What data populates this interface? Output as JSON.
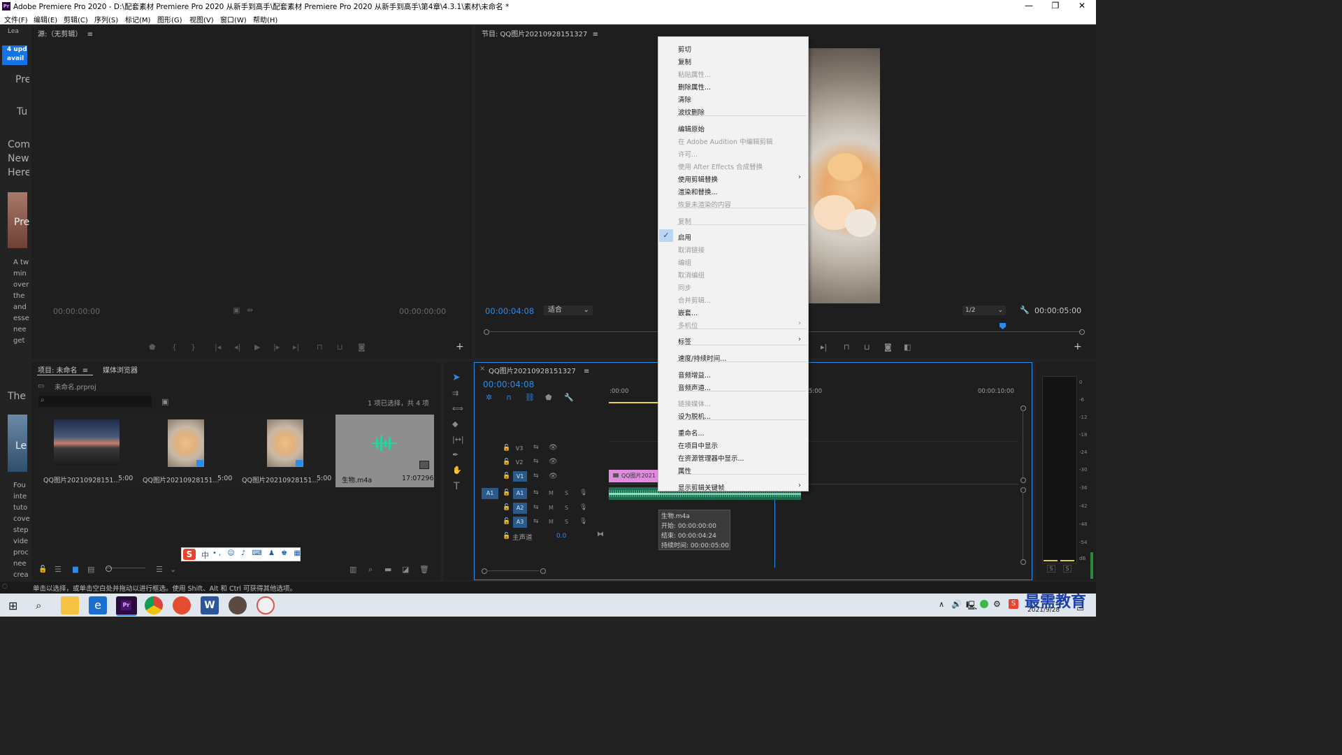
{
  "window": {
    "title": "Adobe Premiere Pro 2020 - D:\\配套素材 Premiere Pro 2020 从新手到高手\\配套素材 Premiere Pro 2020 从新手到高手\\第4章\\4.3.1\\素材\\未命名 *",
    "app_icon": "Pr",
    "minimize": "—",
    "restore": "❐",
    "close": "✕"
  },
  "menu": [
    "文件(F)",
    "编辑(E)",
    "剪辑(C)",
    "序列(S)",
    "标记(M)",
    "图形(G)",
    "视图(V)",
    "窗口(W)",
    "帮助(H)"
  ],
  "learn_panel": {
    "tab": "Lea",
    "badge": "4 upd avail",
    "lines": [
      "Pre",
      "Tu",
      "Com",
      "New",
      "Here",
      "Pre",
      "A tw",
      "min",
      "over",
      "the",
      "and",
      "esse",
      "nee",
      "get",
      "The",
      "Le",
      "Fou",
      "inte",
      "tuto",
      "cove",
      "step",
      "vide",
      "proc",
      "nee",
      "crea"
    ]
  },
  "source_monitor": {
    "title": "源:（无剪辑）",
    "menu_icon": "≡",
    "tc_left": "00:00:00:00",
    "tc_right": "00:00:00:00"
  },
  "program_monitor": {
    "title": "节目: QQ图片20210928151327",
    "menu_icon": "≡",
    "timecode": "00:00:04:08",
    "fit": "适合",
    "resolution": "1/2",
    "duration": "00:00:05:00"
  },
  "context_menu": {
    "items": [
      {
        "label": "剪切",
        "enabled": true
      },
      {
        "label": "复制",
        "enabled": true
      },
      {
        "label": "粘贴属性...",
        "enabled": false
      },
      {
        "label": "删除属性...",
        "enabled": true
      },
      {
        "label": "清除",
        "enabled": true
      },
      {
        "label": "波纹删除",
        "enabled": true
      },
      {
        "label": "编辑原始",
        "enabled": true
      },
      {
        "label": "在 Adobe Audition 中编辑剪辑",
        "enabled": false
      },
      {
        "label": "许可...",
        "enabled": false
      },
      {
        "label": "使用 After Effects 合成替换",
        "enabled": false
      },
      {
        "label": "使用剪辑替换",
        "enabled": true,
        "submenu": true
      },
      {
        "label": "渲染和替换...",
        "enabled": true
      },
      {
        "label": "恢复未渲染的内容",
        "enabled": false
      },
      {
        "label": "复制",
        "enabled": false
      },
      {
        "label": "启用",
        "enabled": true,
        "checked": true
      },
      {
        "label": "取消链接",
        "enabled": false
      },
      {
        "label": "编组",
        "enabled": false
      },
      {
        "label": "取消编组",
        "enabled": false
      },
      {
        "label": "同步",
        "enabled": false
      },
      {
        "label": "合并剪辑...",
        "enabled": false
      },
      {
        "label": "嵌套...",
        "enabled": true
      },
      {
        "label": "多机位",
        "enabled": false,
        "submenu": true
      },
      {
        "label": "标签",
        "enabled": true,
        "submenu": true
      },
      {
        "label": "速度/持续时间...",
        "enabled": true
      },
      {
        "label": "音频增益...",
        "enabled": true
      },
      {
        "label": "音频声道...",
        "enabled": true
      },
      {
        "label": "链接媒体...",
        "enabled": false
      },
      {
        "label": "设为脱机...",
        "enabled": true
      },
      {
        "label": "重命名...",
        "enabled": true
      },
      {
        "label": "在项目中显示",
        "enabled": true
      },
      {
        "label": "在资源管理器中显示...",
        "enabled": true
      },
      {
        "label": "属性",
        "enabled": true
      },
      {
        "label": "显示剪辑关键帧",
        "enabled": true,
        "submenu": true
      }
    ],
    "check_mark": "✓",
    "submenu_arrow": "›"
  },
  "project_panel": {
    "tab_project": "项目: 未命名",
    "tab_menu": "≡",
    "tab_media": "媒体浏览器",
    "project_file": "未命名.prproj",
    "selection_info": "1 项已选择，共 4 项",
    "items": [
      {
        "name": "QQ图片20210928151...",
        "duration": "5:00"
      },
      {
        "name": "QQ图片20210928151...",
        "duration": "5:00"
      },
      {
        "name": "QQ图片20210928151...",
        "duration": "5:00"
      },
      {
        "name": "生物.m4a",
        "duration": "17:07296"
      }
    ]
  },
  "ime_toolbar": {
    "logo": "S",
    "lang": "中",
    "icons": "•, ☺ ♪ ⌨ ♟ ♚ ▦"
  },
  "timeline": {
    "tab": "QQ图片20210928151327",
    "tab_close": "×",
    "tab_menu": "≡",
    "timecode": "00:00:04:08",
    "ruler": [
      ":00:00",
      "5:00",
      "00:00:10:00"
    ],
    "tracks": [
      {
        "name": "V3"
      },
      {
        "name": "V2"
      },
      {
        "name": "V1"
      },
      {
        "name": "A1"
      },
      {
        "name": "A2"
      },
      {
        "name": "A3"
      }
    ],
    "source_patch_a1": "A1",
    "master_label": "主声道",
    "master_value": "0.0",
    "track_m": "M",
    "track_s": "S",
    "video_clip": "QQ图片2021",
    "tooltip": {
      "name": "生物.m4a",
      "start": "开始: 00:00:00:00",
      "end": "结束: 00:00:04:24",
      "duration": "持续时间: 00:00:05:00"
    }
  },
  "audio_meter": {
    "scale": [
      "0",
      "-6",
      "-12",
      "-18",
      "-24",
      "-30",
      "-36",
      "-42",
      "-48",
      "-54",
      "dB"
    ],
    "solo_left": "S",
    "solo_right": "S"
  },
  "status_bar": {
    "text": "单击以选择，或单击空白处并拖动以进行框选。使用 Shift、Alt 和 Ctrl 可获得其他选项。"
  },
  "taskbar": {
    "watermark": "最需教育",
    "date": "2021/9/28"
  },
  "colors": {
    "accent_blue": "#2d8ceb",
    "video_clip": "#e08ae0",
    "audio_clip": "#1e7a5a",
    "menu_bg": "#f2f2f2"
  }
}
